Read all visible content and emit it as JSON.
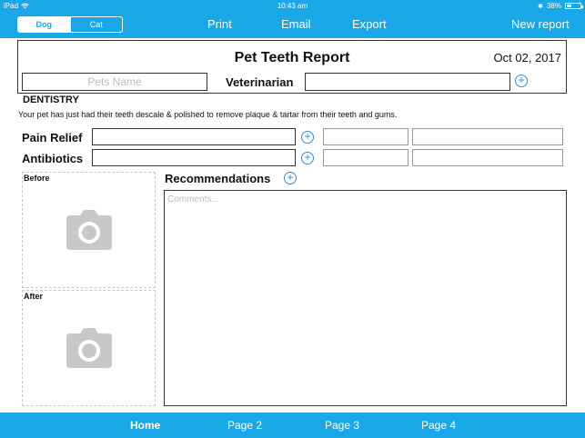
{
  "status_bar": {
    "device": "iPad",
    "time": "10:43 am",
    "bluetooth": "✱",
    "battery_percent": "38%",
    "battery_level": 0.38
  },
  "nav": {
    "segments": [
      "Dog",
      "Cat"
    ],
    "selected_segment": "Dog",
    "print": "Print",
    "email": "Email",
    "export": "Export",
    "new_report": "New report"
  },
  "report": {
    "title": "Pet Teeth Report",
    "date": "Oct 02, 2017",
    "pets_name_placeholder": "Pets Name",
    "veterinarian_label": "Veterinarian",
    "section_title": "DENTISTRY",
    "description": "Your pet has just had their teeth descale & polished to remove plaque & tartar from their teeth and gums.",
    "pain_relief_label": "Pain Relief",
    "antibiotics_label": "Antibiotics",
    "before_label": "Before",
    "after_label": "After",
    "recommendations_label": "Recommendations",
    "comments_placeholder": "Comments..."
  },
  "icons": {
    "add": "+",
    "camera": "camera-icon"
  },
  "tabs": [
    "Home",
    "Page 2",
    "Page 3",
    "Page 4"
  ],
  "active_tab": "Home",
  "colors": {
    "accent": "#1aa7e8",
    "plus_icon": "#2a8ee0",
    "camera_icon": "#c8c8c8"
  }
}
